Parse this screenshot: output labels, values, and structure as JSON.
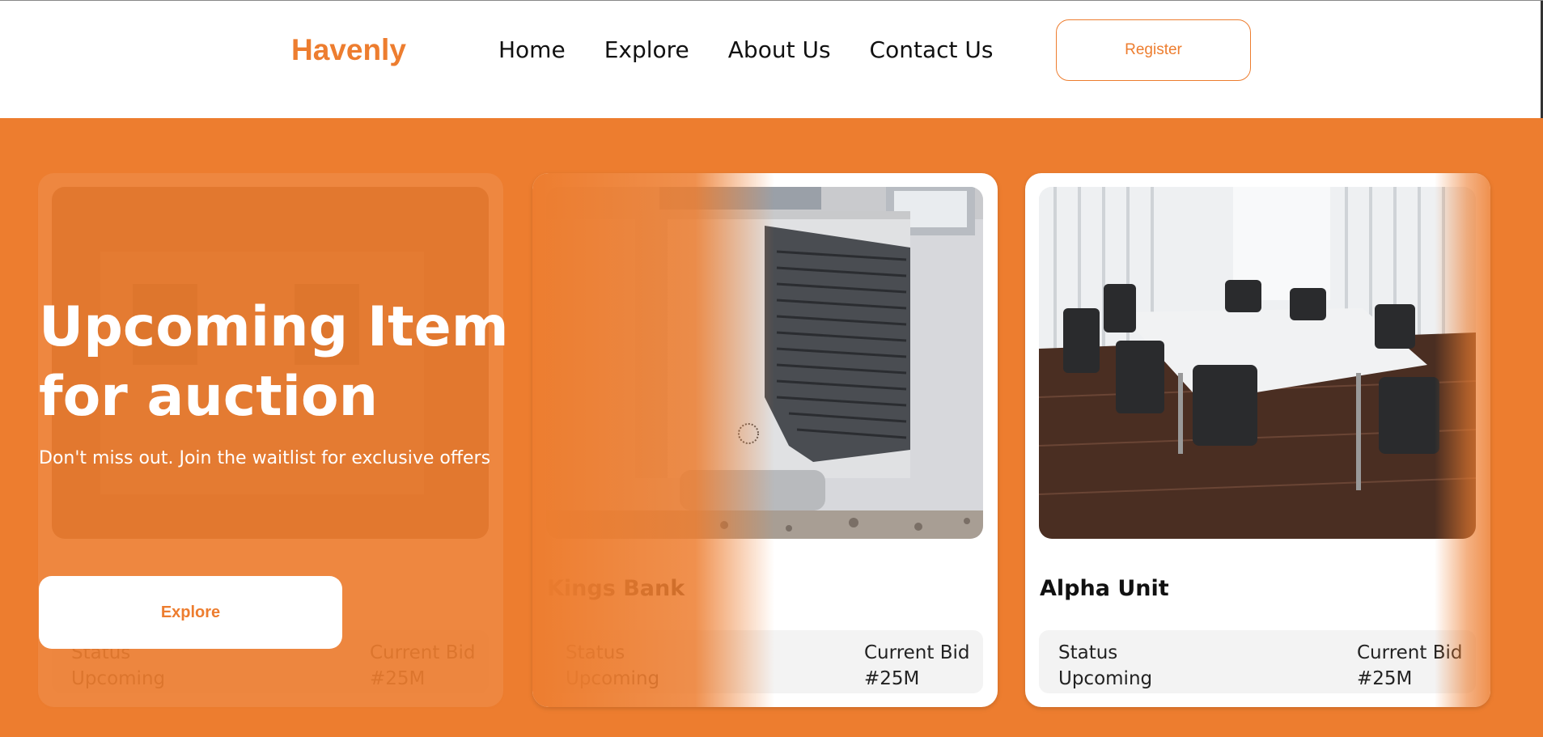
{
  "header": {
    "logo": "Havenly",
    "nav": [
      "Home",
      "Explore",
      "About Us",
      "Contact Us"
    ],
    "register_label": "Register"
  },
  "hero": {
    "title": "Upcoming Item for auction",
    "subtitle": "Don't miss out. Join the waitlist for exclusive offers",
    "explore_label": "Explore"
  },
  "cards": [
    {
      "title": "",
      "status_label": "Status",
      "status_value": "Upcoming",
      "bid_label": "Current Bid",
      "bid_value": "#25M",
      "image": "building-photo"
    },
    {
      "title": "Kings Bank",
      "status_label": "Status",
      "status_value": "Upcoming",
      "bid_label": "Current Bid",
      "bid_value": "#25M",
      "image": "heat-pump-unit-photo"
    },
    {
      "title": "Alpha Unit",
      "status_label": "Status",
      "status_value": "Upcoming",
      "bid_label": "Current Bid",
      "bid_value": "#25M",
      "image": "conference-room-photo"
    }
  ],
  "colors": {
    "accent": "#ED7D2F",
    "white": "#FFFFFF"
  }
}
